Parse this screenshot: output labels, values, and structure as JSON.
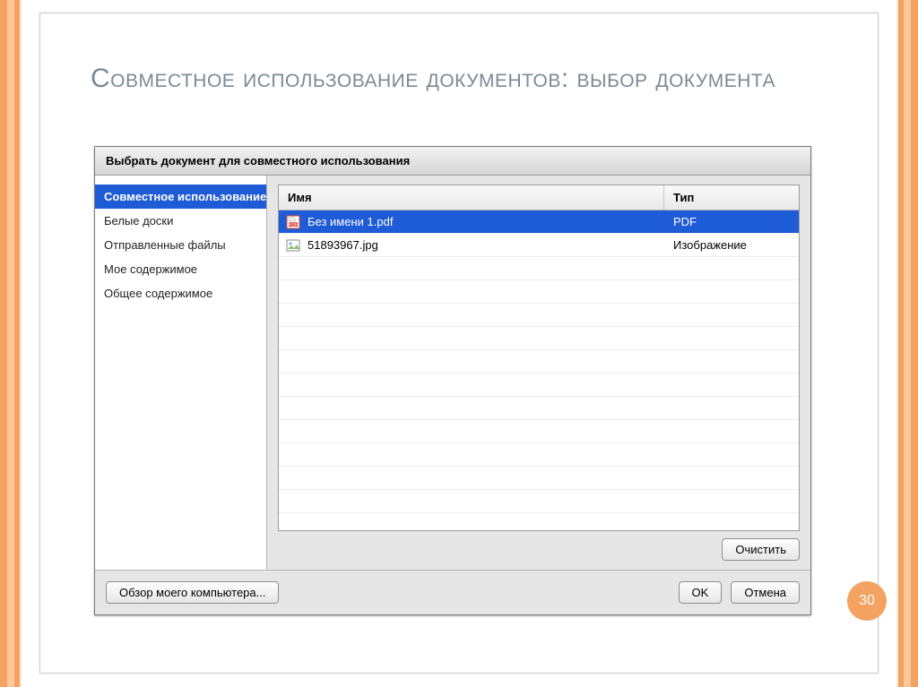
{
  "slide": {
    "title": "Совместное использование документов: выбор документа",
    "page_number": "30"
  },
  "dialog": {
    "title": "Выбрать документ для совместного использования",
    "sidebar": {
      "items": [
        {
          "label": "Совместное использование",
          "selected": true
        },
        {
          "label": "Белые доски",
          "selected": false
        },
        {
          "label": "Отправленные файлы",
          "selected": false
        },
        {
          "label": "Мое содержимое",
          "selected": false
        },
        {
          "label": "Общее содержимое",
          "selected": false
        }
      ]
    },
    "table": {
      "columns": {
        "name": "Имя",
        "type": "Тип"
      },
      "rows": [
        {
          "icon": "pdf",
          "name": "Без имени 1.pdf",
          "type": "PDF",
          "selected": true
        },
        {
          "icon": "image",
          "name": "51893967.jpg",
          "type": "Изображение",
          "selected": false
        }
      ]
    },
    "buttons": {
      "clear": "Очистить",
      "browse": "Обзор моего компьютера...",
      "ok": "OK",
      "cancel": "Отмена"
    }
  }
}
